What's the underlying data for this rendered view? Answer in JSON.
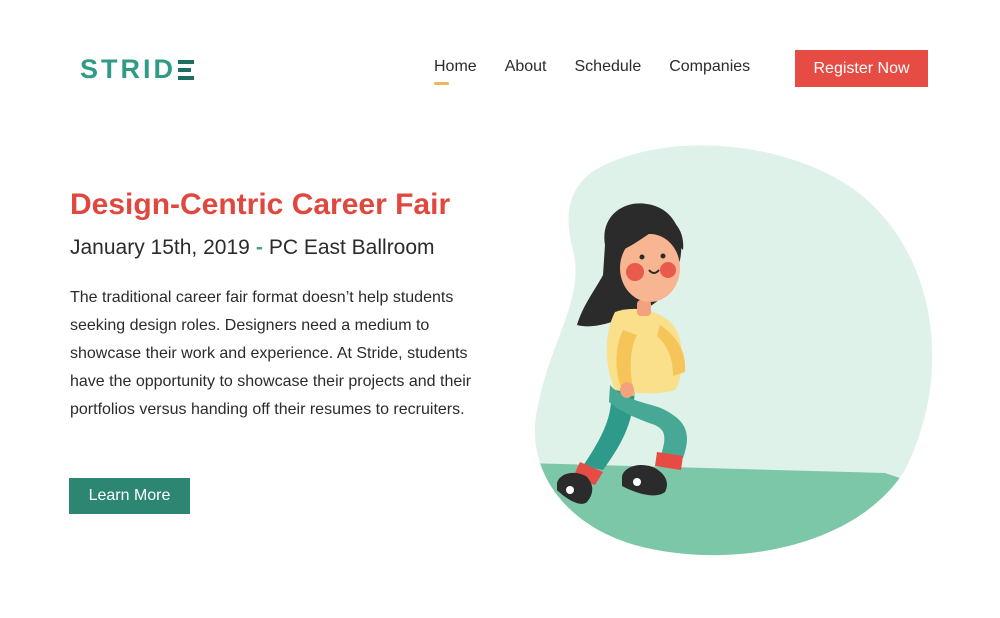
{
  "brand": {
    "name": "STRID"
  },
  "nav": {
    "items": [
      {
        "label": "Home",
        "active": true
      },
      {
        "label": "About",
        "active": false
      },
      {
        "label": "Schedule",
        "active": false
      },
      {
        "label": "Companies",
        "active": false
      }
    ],
    "register_label": "Register Now"
  },
  "hero": {
    "title": "Design-Centric Career Fair",
    "date": "January 15th, 2019",
    "separator": "-",
    "location": "PC East Ballroom",
    "description": "The traditional career fair format doesn’t help students seeking design roles. Designers need a medium to showcase their work and experience. At Stride, students have the opportunity to showcase their projects and their portfolios versus handing off their resumes to recruiters.",
    "cta_label": "Learn More"
  },
  "colors": {
    "brand": "#2f9a86",
    "accent": "#e64c43",
    "cta": "#2c8672",
    "nav_underline": "#f2b460",
    "blob": "#dff2ea",
    "ground": "#7bc7a8"
  },
  "illustration": {
    "subject": "girl-walking-illustration"
  }
}
